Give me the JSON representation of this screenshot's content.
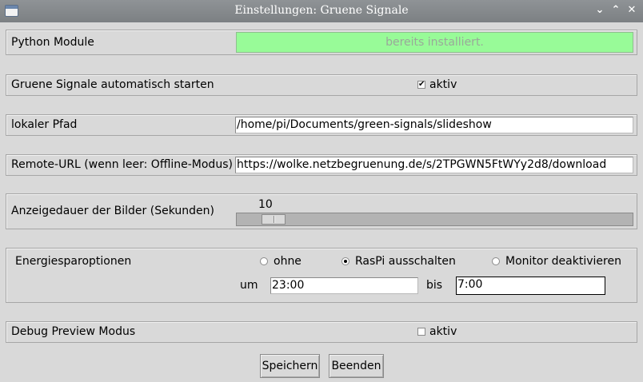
{
  "window": {
    "title": "Einstellungen: Gruene Signale",
    "controls": {
      "minimize": "⌄",
      "maximize": "⌃",
      "close": "✕"
    }
  },
  "python_module": {
    "label": "Python Module",
    "status": "bereits installiert.",
    "status_bg": "#98fb98"
  },
  "autostart": {
    "label": "Gruene Signale automatisch starten",
    "checkbox_label": "aktiv",
    "checked": true
  },
  "local_path": {
    "label": "lokaler Pfad",
    "value": "/home/pi/Documents/green-signals/slideshow"
  },
  "remote_url": {
    "label": "Remote-URL (wenn leer: Offline-Modus)",
    "value": "https://wolke.netzbegruenung.de/s/2TPGWN5FtWYy2d8/download"
  },
  "display_duration": {
    "label": "Anzeigedauer der Bilder (Sekunden)",
    "value": "10"
  },
  "energy": {
    "label": "Energiesparoptionen",
    "options": [
      {
        "label": "ohne",
        "selected": false
      },
      {
        "label": "RasPi ausschalten",
        "selected": true
      },
      {
        "label": "Monitor deaktivieren",
        "selected": false
      }
    ],
    "from_label": "um",
    "from_value": "23:00",
    "to_label": "bis",
    "to_value": "7:00"
  },
  "debug": {
    "label": "Debug Preview Modus",
    "checkbox_label": "aktiv",
    "checked": false
  },
  "buttons": {
    "save": "Speichern",
    "quit": "Beenden"
  }
}
